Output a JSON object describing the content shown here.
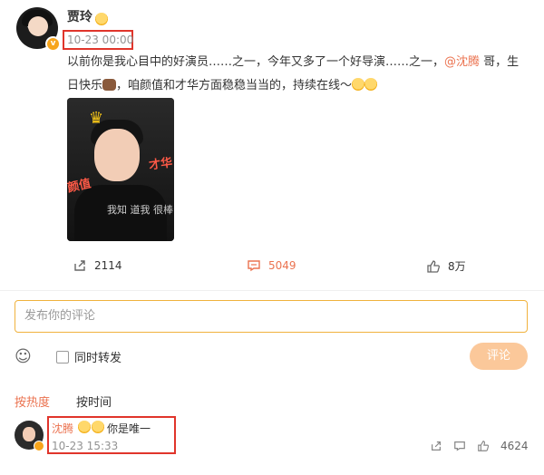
{
  "post": {
    "username": "贾玲",
    "timestamp": "10-23 00:00",
    "text_before_mention": "以前你是我心目中的好演员……之一，今年又多了一个好导演……之一，",
    "mention": "@沈腾",
    "text_after_mention": " 哥，生日快乐",
    "text_tail": "，咱颜值和才华方面稳稳当当的，持续在线～",
    "image_overlay": {
      "left_tag": "颜值",
      "right_tag": "才华",
      "shirt_text": "我知 道我 很棒"
    }
  },
  "actions": {
    "share": {
      "icon": "share-icon",
      "count": "2114"
    },
    "comment": {
      "icon": "comment-icon",
      "count": "5049"
    },
    "like": {
      "icon": "thumbs-up-icon",
      "count": "8万"
    }
  },
  "compose": {
    "placeholder": "发布你的评论",
    "also_repost_label": "同时转发",
    "submit_label": "评论"
  },
  "sort": {
    "hot_label": "按热度",
    "time_label": "按时间"
  },
  "comment": {
    "username": "沈腾",
    "text": "你是唯一",
    "timestamp": "10-23 15:33",
    "like_count": "4624"
  },
  "colors": {
    "accent": "#eb7350",
    "highlight_box": "#e0352b",
    "input_border": "#f0b23d",
    "submit_bg": "#fbc89a"
  }
}
